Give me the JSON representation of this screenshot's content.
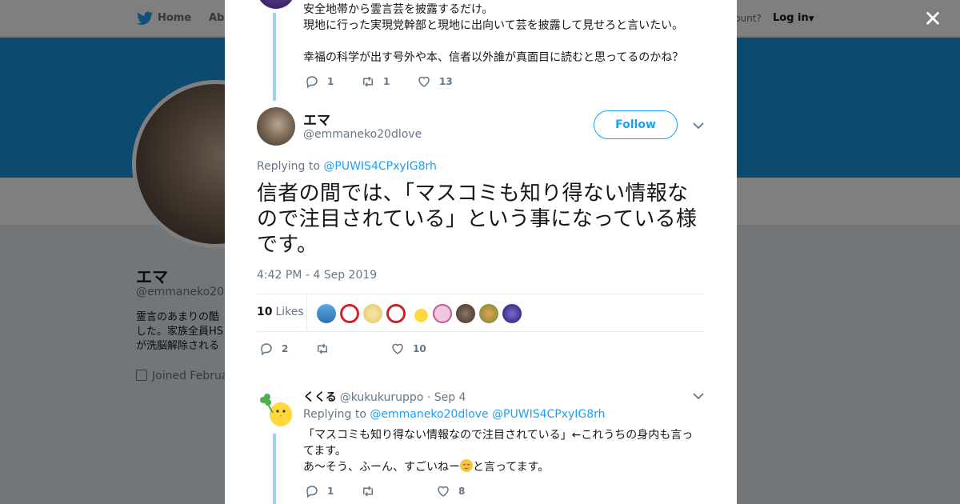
{
  "background": {
    "nav": {
      "home": "Home",
      "about": "Abo",
      "account": "ccount?",
      "login": "Log in"
    },
    "profile": {
      "name": "エマ",
      "handle": "@emmaneko20dl",
      "bio": [
        "霊言のあまりの酷",
        "した。家族全員HS",
        "が洗脳解除される"
      ],
      "joined": "Joined Februa"
    }
  },
  "modal": {
    "close": "✕",
    "previous_tweet": {
      "lines": [
        "安全地帯から霊言芸を披露するだけ。",
        "現地に行った実現党幹部と現地に出向いて芸を披露して見せろと言いたい。",
        "",
        "幸福の科学が出す号外や本、信者以外誰が真面目に読むと思ってるのかね？"
      ],
      "replies": "1",
      "retweets": "1",
      "likes": "13"
    },
    "main_tweet": {
      "name": "エマ",
      "handle": "@emmaneko20dlove",
      "follow_label": "Follow",
      "replying_prefix": "Replying to",
      "replying_to": "@PUWIS4CPxyIG8rh",
      "text": "信者の間では、「マスコミも知り得ない情報なので注目されている」という事になっている様です。",
      "timestamp": "4:42 PM - 4 Sep 2019",
      "likes_number": "10",
      "likes_label": "Likes",
      "replies": "2",
      "retweets": "",
      "likes": "10"
    },
    "reply_tweet": {
      "name": "くくる",
      "handle": "@kukukuruppo",
      "date": "· Sep 4",
      "replying_prefix": "Replying to",
      "replying_to": [
        "@emmaneko20dlove",
        "@PUWIS4CPxyIG8rh"
      ],
      "text_line1": "「マスコミも知り得ない情報なので注目されている」←これうちの身内も言ってます。",
      "text_line2a": "あ〜そう、ふーん、すごいねー",
      "text_line2b": "と言ってます。",
      "replies": "1",
      "retweets": "",
      "likes": "8"
    }
  },
  "colors": {
    "accent": "#1da1f2",
    "thread_line": "#9ed3f5",
    "banner": "#1b95e0"
  }
}
